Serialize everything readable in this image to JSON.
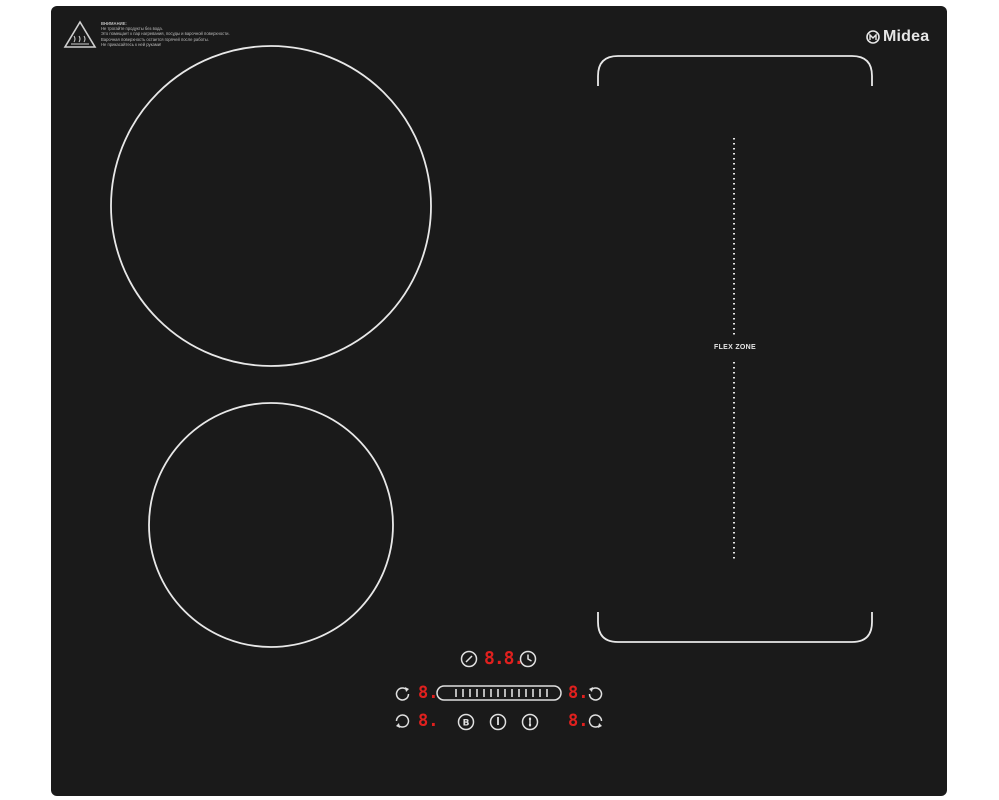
{
  "brand": {
    "name": "Midea"
  },
  "warning": {
    "title": "ВНИМАНИЕ:",
    "lines": [
      "Не трогайте продукты без вода.",
      "Это помещает к пар нагревания, посуды и варочной поверхности.",
      "Варочная поверхность остается горячей после работы.",
      "Не прикасайтесь к ней руками!"
    ]
  },
  "zones": {
    "flex_label": "FLEX ZONE"
  },
  "controls": {
    "timer_display": "8.8.",
    "zone_display_top_left": "8.",
    "zone_display_bottom_left": "8.",
    "zone_display_top_right": "8.",
    "zone_display_bottom_right": "8."
  },
  "colors": {
    "glass": "#1a1a1a",
    "ring": "#e8e8e8",
    "display_red": "#e0201e"
  }
}
